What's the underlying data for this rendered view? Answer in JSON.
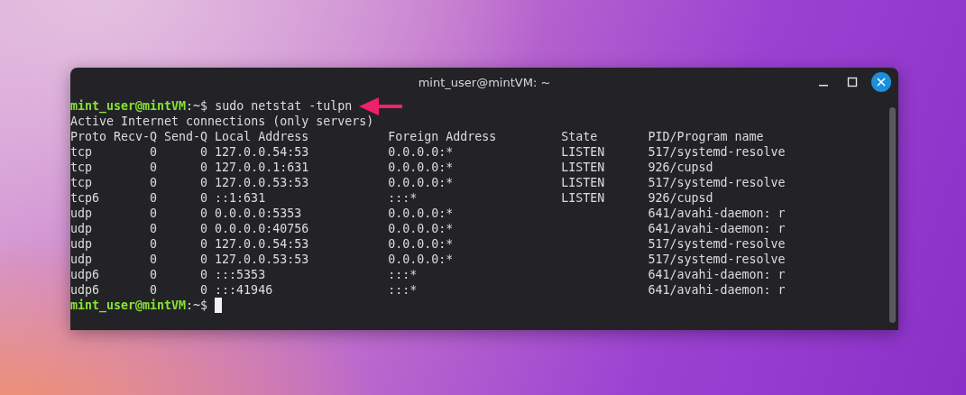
{
  "window": {
    "title": "mint_user@mintVM: ~"
  },
  "terminal": {
    "lines": [
      {
        "kind": "prompt",
        "user_host": "mint_user@mintVM",
        "path": ":~$",
        "command": "sudo netstat -tulpn",
        "annotated": true,
        "cursor": false
      },
      {
        "kind": "text",
        "text": "Active Internet connections (only servers)"
      },
      {
        "kind": "header",
        "proto": "Proto",
        "recv_q": "Recv-Q",
        "send_q": "Send-Q",
        "local_address": "Local Address",
        "foreign_address": "Foreign Address",
        "state": "State",
        "program": "PID/Program name"
      },
      {
        "kind": "row",
        "proto": "tcp",
        "recv_q": "0",
        "send_q": "0",
        "local_address": "127.0.0.54:53",
        "foreign_address": "0.0.0.0:*",
        "state": "LISTEN",
        "program": "517/systemd-resolve"
      },
      {
        "kind": "row",
        "proto": "tcp",
        "recv_q": "0",
        "send_q": "0",
        "local_address": "127.0.0.1:631",
        "foreign_address": "0.0.0.0:*",
        "state": "LISTEN",
        "program": "926/cupsd"
      },
      {
        "kind": "row",
        "proto": "tcp",
        "recv_q": "0",
        "send_q": "0",
        "local_address": "127.0.0.53:53",
        "foreign_address": "0.0.0.0:*",
        "state": "LISTEN",
        "program": "517/systemd-resolve"
      },
      {
        "kind": "row",
        "proto": "tcp6",
        "recv_q": "0",
        "send_q": "0",
        "local_address": "::1:631",
        "foreign_address": ":::*",
        "state": "LISTEN",
        "program": "926/cupsd"
      },
      {
        "kind": "row",
        "proto": "udp",
        "recv_q": "0",
        "send_q": "0",
        "local_address": "0.0.0.0:5353",
        "foreign_address": "0.0.0.0:*",
        "program": "641/avahi-daemon: r"
      },
      {
        "kind": "row",
        "proto": "udp",
        "recv_q": "0",
        "send_q": "0",
        "local_address": "0.0.0.0:40756",
        "foreign_address": "0.0.0.0:*",
        "program": "641/avahi-daemon: r"
      },
      {
        "kind": "row",
        "proto": "udp",
        "recv_q": "0",
        "send_q": "0",
        "local_address": "127.0.0.54:53",
        "foreign_address": "0.0.0.0:*",
        "program": "517/systemd-resolve"
      },
      {
        "kind": "row",
        "proto": "udp",
        "recv_q": "0",
        "send_q": "0",
        "local_address": "127.0.0.53:53",
        "foreign_address": "0.0.0.0:*",
        "program": "517/systemd-resolve"
      },
      {
        "kind": "row",
        "proto": "udp6",
        "recv_q": "0",
        "send_q": "0",
        "local_address": ":::5353",
        "foreign_address": ":::*",
        "program": "641/avahi-daemon: r"
      },
      {
        "kind": "row",
        "proto": "udp6",
        "recv_q": "0",
        "send_q": "0",
        "local_address": ":::41946",
        "foreign_address": ":::*",
        "program": "641/avahi-daemon: r"
      },
      {
        "kind": "prompt",
        "user_host": "mint_user@mintVM",
        "path": ":~$",
        "annotated": false,
        "cursor": true
      }
    ]
  }
}
